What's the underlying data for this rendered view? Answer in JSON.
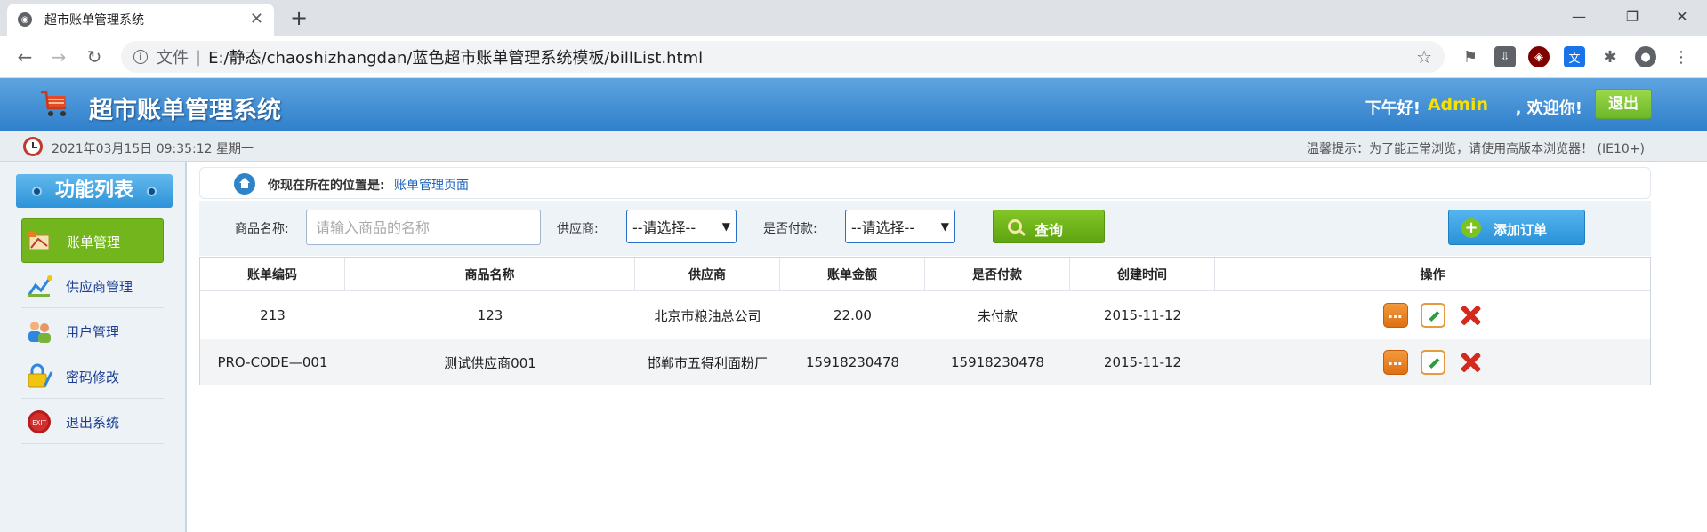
{
  "browser": {
    "tab_title": "超市账单管理系统",
    "url_scheme": "文件",
    "url": "E:/静态/chaoshizhangdan/蓝色超市账单管理系统模板/billList.html"
  },
  "header": {
    "title": "超市账单管理系统",
    "greeting": "下午好!",
    "username": "Admin",
    "welcome": ", 欢迎你!",
    "logout_label": "退出"
  },
  "status": {
    "datetime": "2021年03月15日 09:35:12 星期一",
    "tip": "温馨提示：为了能正常浏览，请使用高版本浏览器！ (IE10+)"
  },
  "sidebar": {
    "title": "功能列表",
    "items": [
      {
        "label": "账单管理",
        "icon": "bill-icon",
        "active": true
      },
      {
        "label": "供应商管理",
        "icon": "supplier-icon",
        "active": false
      },
      {
        "label": "用户管理",
        "icon": "users-icon",
        "active": false
      },
      {
        "label": "密码修改",
        "icon": "password-icon",
        "active": false
      },
      {
        "label": "退出系统",
        "icon": "exit-icon",
        "active": false
      }
    ]
  },
  "breadcrumb": {
    "label": "你现在所在的位置是:",
    "page": "账单管理页面"
  },
  "search": {
    "product_label": "商品名称:",
    "product_placeholder": "请输入商品的名称",
    "supplier_label": "供应商:",
    "supplier_value": "--请选择--",
    "paid_label": "是否付款:",
    "paid_value": "--请选择--",
    "query_label": "查询",
    "add_label": "添加订单"
  },
  "table": {
    "headers": [
      "账单编码",
      "商品名称",
      "供应商",
      "账单金额",
      "是否付款",
      "创建时间",
      "操作"
    ],
    "rows": [
      {
        "code": "213",
        "product": "123",
        "supplier": "北京市粮油总公司",
        "amount": "22.00",
        "paid": "未付款",
        "created": "2015-11-12"
      },
      {
        "code": "PRO-CODE—001",
        "product": "测试供应商001",
        "supplier": "邯郸市五得利面粉厂",
        "amount": "15918230478",
        "paid": "15918230478",
        "created": "2015-11-12"
      }
    ]
  },
  "colors": {
    "header_blue": "#2f7fcb",
    "active_green": "#72b51d",
    "username_yellow": "#f8e000",
    "delete_red": "#d42a1e"
  }
}
